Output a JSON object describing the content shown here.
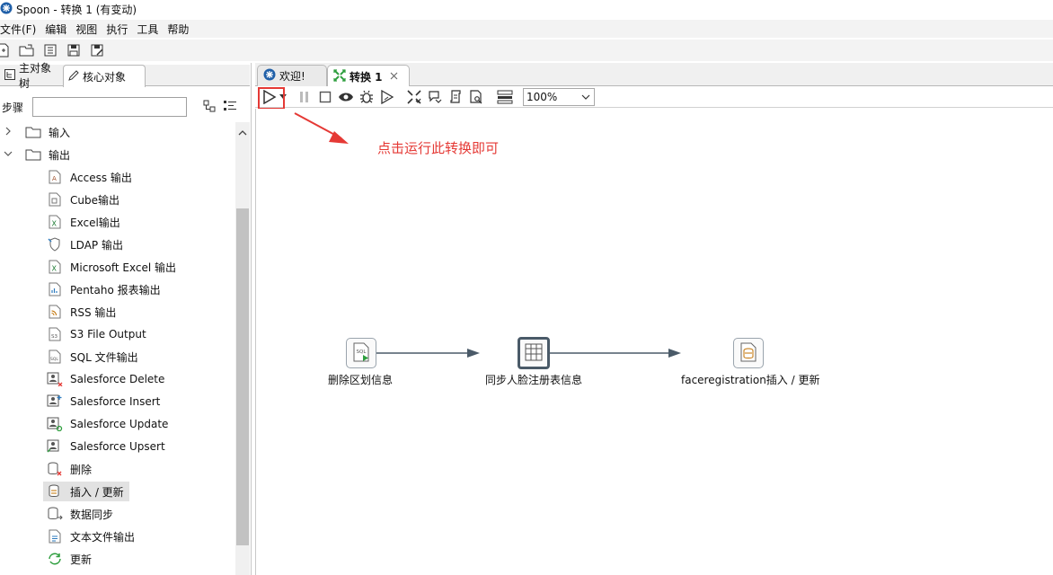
{
  "window": {
    "title": "Spoon - 转换 1 (有变动)"
  },
  "menu": [
    "文件(F)",
    "编辑",
    "视图",
    "执行",
    "工具",
    "帮助"
  ],
  "left": {
    "tabs": [
      "主对象树",
      "核心对象"
    ],
    "step_label": "步骤",
    "search_value": "",
    "tree": [
      {
        "label": "输入",
        "kind": "folder",
        "expanded": false
      },
      {
        "label": "输出",
        "kind": "folder",
        "expanded": true
      },
      {
        "label": "Access 输出",
        "icon": "access-output-icon"
      },
      {
        "label": "Cube输出",
        "icon": "cube-output-icon"
      },
      {
        "label": "Excel输出",
        "icon": "excel-output-icon"
      },
      {
        "label": "LDAP 输出",
        "icon": "ldap-output-icon"
      },
      {
        "label": "Microsoft Excel 输出",
        "icon": "ms-excel-output-icon"
      },
      {
        "label": "Pentaho 报表输出",
        "icon": "pentaho-report-icon"
      },
      {
        "label": "RSS 输出",
        "icon": "rss-output-icon"
      },
      {
        "label": "S3 File Output",
        "icon": "s3-file-icon"
      },
      {
        "label": "SQL 文件输出",
        "icon": "sql-file-icon"
      },
      {
        "label": "Salesforce Delete",
        "icon": "salesforce-delete-icon"
      },
      {
        "label": "Salesforce Insert",
        "icon": "salesforce-insert-icon"
      },
      {
        "label": "Salesforce Update",
        "icon": "salesforce-update-icon"
      },
      {
        "label": "Salesforce Upsert",
        "icon": "salesforce-upsert-icon"
      },
      {
        "label": "删除",
        "icon": "delete-icon"
      },
      {
        "label": "插入 / 更新",
        "icon": "insert-update-icon",
        "selected": true
      },
      {
        "label": "数据同步",
        "icon": "data-sync-icon"
      },
      {
        "label": "文本文件输出",
        "icon": "text-file-output-icon"
      },
      {
        "label": "更新",
        "icon": "update-icon"
      }
    ]
  },
  "editor": {
    "tabs": [
      {
        "label": "欢迎!"
      },
      {
        "label": "转换 1"
      }
    ],
    "zoom": "100%",
    "annotation": "点击运行此转换即可",
    "steps": [
      {
        "label": "删除区划信息",
        "icon": "sql-script-icon"
      },
      {
        "label": "同步人脸注册表信息",
        "icon": "table-input-icon"
      },
      {
        "label": "faceregistration插入 / 更新",
        "icon": "insert-update-icon"
      }
    ]
  },
  "colors": {
    "accent": "#e53935",
    "hop": "#4a5a68",
    "selection": "#e2e2e2"
  }
}
